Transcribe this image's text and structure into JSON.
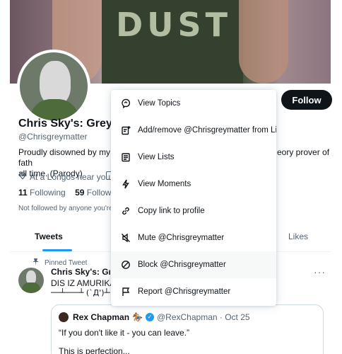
{
  "profile": {
    "name": "Chris Sky's: Grey M",
    "handle": "@Chrisgreymatter",
    "bio_left": "Proudly disowned by my fath",
    "bio_left_2": "all time. (Parody)",
    "bio_right": "eory prover of",
    "location": "At a Longos near you.",
    "following_count": "11",
    "following_label": "Following",
    "followers_count": "59",
    "followers_label": "Followers",
    "not_followed": "Not followed by anyone you're fo",
    "follow_button": "Follow"
  },
  "tabs": {
    "tweets": "Tweets",
    "likes": "Likes"
  },
  "tweet": {
    "pinned_label": "Pinned Tweet",
    "author": "Chris Sky's: Grey",
    "line1": "DIS IZ AMURIKA!",
    "line2": "──┴───┴ (`Д')┴──┴",
    "more": "···",
    "quote": {
      "author": "Rex Chapman",
      "emoji": "🏇",
      "handle_time": "@RexChapman · Oct 25",
      "text1": "“If you don't like it - you can leave.”",
      "text2": "This is perfection..."
    }
  },
  "menu": {
    "items": [
      {
        "label": "View Topics",
        "icon": "topics-icon"
      },
      {
        "label": "Add/remove @Chrisgreymatter from Lists",
        "icon": "add-list-icon"
      },
      {
        "label": "View Lists",
        "icon": "lists-icon"
      },
      {
        "label": "View Moments",
        "icon": "moments-icon"
      },
      {
        "label": "Copy link to profile",
        "icon": "link-icon"
      },
      {
        "label": "Mute @Chrisgreymatter",
        "icon": "mute-icon"
      },
      {
        "label": "Block @Chrisgreymatter",
        "icon": "block-icon"
      },
      {
        "label": "Report @Chrisgreymatter",
        "icon": "report-icon"
      }
    ]
  },
  "colors": {
    "accent": "#1d9bf0",
    "text": "#0f1419",
    "muted": "#536471"
  }
}
